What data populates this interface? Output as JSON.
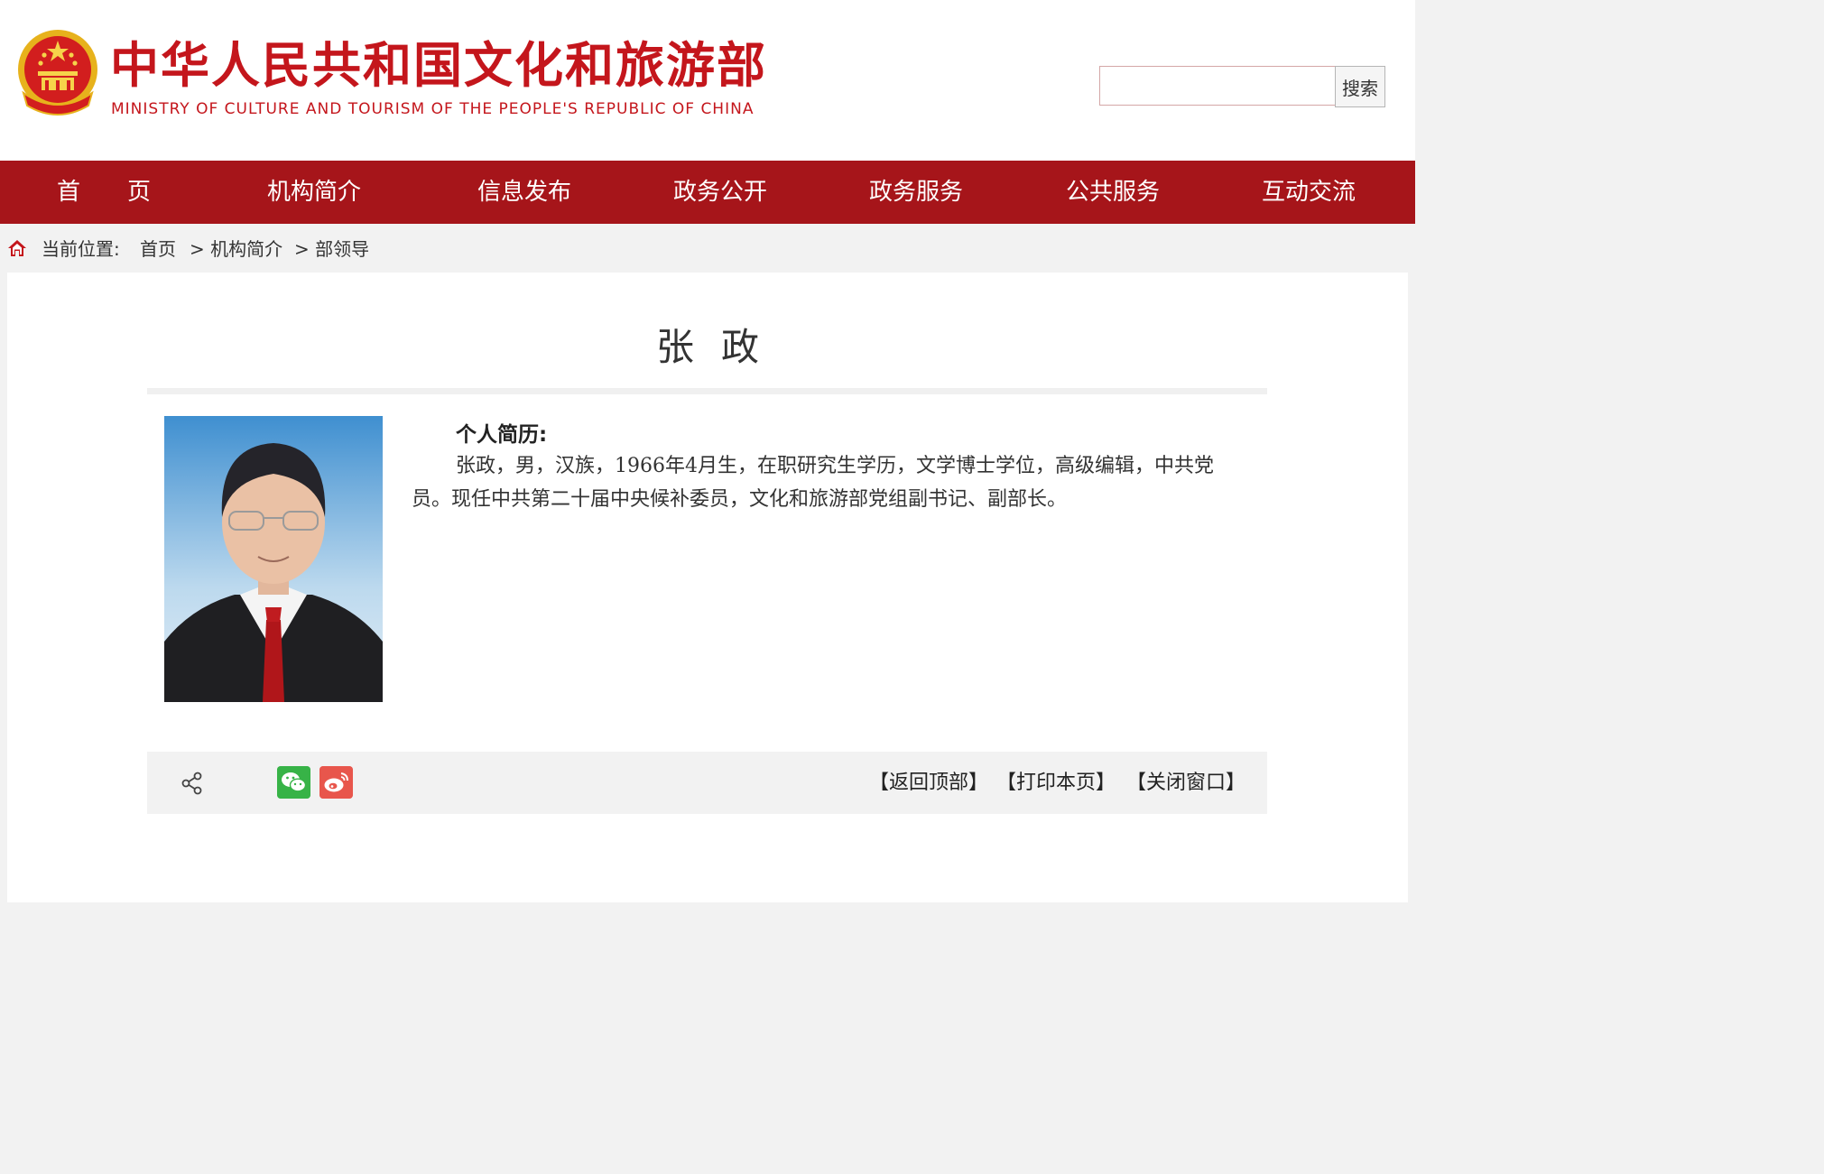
{
  "header": {
    "title": "中华人民共和国文化和旅游部",
    "subtitle": "MINISTRY OF CULTURE AND TOURISM OF THE PEOPLE'S REPUBLIC OF CHINA",
    "emblem_icon": "national-emblem-icon",
    "search": {
      "value": "",
      "placeholder": "",
      "button_label": "搜索"
    }
  },
  "nav": {
    "items": [
      {
        "label": "首　　页"
      },
      {
        "label": "机构简介"
      },
      {
        "label": "信息发布"
      },
      {
        "label": "政务公开"
      },
      {
        "label": "政务服务"
      },
      {
        "label": "公共服务"
      },
      {
        "label": "互动交流"
      }
    ]
  },
  "breadcrumb": {
    "home_icon": "home-icon",
    "label": "当前位置:",
    "items": [
      {
        "label": "首页"
      },
      {
        "label": "> 机构简介"
      },
      {
        "label": "> 部领导"
      }
    ]
  },
  "profile": {
    "name": "张政",
    "bio_heading": "个人简历:",
    "bio_text": "张政，男，汉族，1966年4月生，在职研究生学历，文学博士学位，高级编辑，中共党员。现任中共第二十届中央候补委员，文化和旅游部党组副书记、副部长。"
  },
  "share": {
    "share_icon": "share-icon",
    "wechat_icon": "wechat-icon",
    "weibo_icon": "weibo-icon",
    "actions": [
      {
        "label": "【返回顶部】"
      },
      {
        "label": "【打印本页】"
      },
      {
        "label": "【关闭窗口】"
      }
    ]
  },
  "colors": {
    "brand_red": "#c4161c",
    "nav_background": "#a6151a",
    "page_background": "#f2f2f2"
  }
}
